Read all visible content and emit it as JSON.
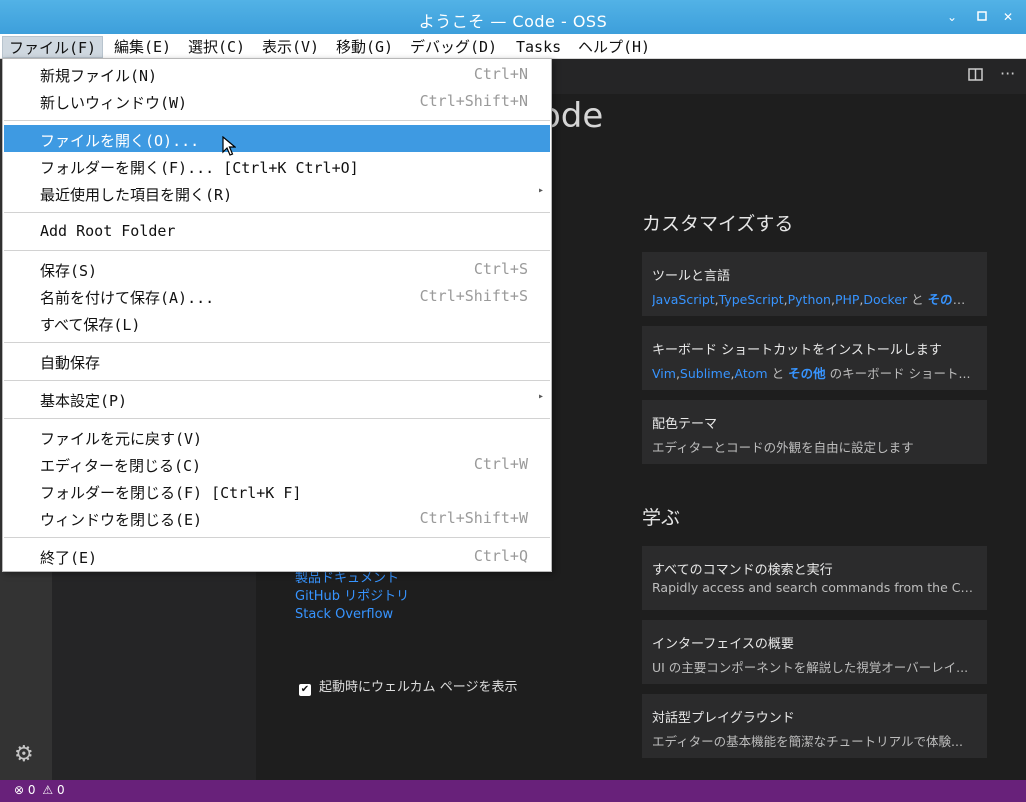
{
  "window": {
    "title": "ようこそ — Code - OSS"
  },
  "menubar": {
    "items": [
      "ファイル(F)",
      "編集(E)",
      "選択(C)",
      "表示(V)",
      "移動(G)",
      "デバッグ(D)",
      "Tasks",
      "ヘルプ(H)"
    ]
  },
  "file_menu": {
    "items": [
      {
        "label": "新規ファイル(N)",
        "shortcut": "Ctrl+N"
      },
      {
        "label": "新しいウィンドウ(W)",
        "shortcut": "Ctrl+Shift+N"
      },
      {
        "label": "ファイルを開く(O)...",
        "shortcut": ""
      },
      {
        "label": "フォルダーを開く(F)... [Ctrl+K Ctrl+O]",
        "shortcut": ""
      },
      {
        "label": "最近使用した項目を開く(R)",
        "shortcut": ""
      },
      {
        "label": "Add Root Folder",
        "shortcut": ""
      },
      {
        "label": "保存(S)",
        "shortcut": "Ctrl+S"
      },
      {
        "label": "名前を付けて保存(A)...",
        "shortcut": "Ctrl+Shift+S"
      },
      {
        "label": "すべて保存(L)",
        "shortcut": ""
      },
      {
        "label": "自動保存",
        "shortcut": ""
      },
      {
        "label": "基本設定(P)",
        "shortcut": ""
      },
      {
        "label": "ファイルを元に戻す(V)",
        "shortcut": ""
      },
      {
        "label": "エディターを閉じる(C)",
        "shortcut": "Ctrl+W"
      },
      {
        "label": "フォルダーを閉じる(F) [Ctrl+K F]",
        "shortcut": ""
      },
      {
        "label": "ウィンドウを閉じる(E)",
        "shortcut": "Ctrl+Shift+W"
      },
      {
        "label": "終了(E)",
        "shortcut": "Ctrl+Q"
      }
    ]
  },
  "welcome": {
    "title_fragment": "ode",
    "customize": {
      "heading": "カスタマイズする",
      "cards": [
        {
          "title": "ツールと言語",
          "links": [
            "JavaScript",
            "TypeScript",
            "Python",
            "PHP",
            "Docker"
          ],
          "conj": "と",
          "more": "その他",
          "tail": "..."
        },
        {
          "title": "キーボード ショートカットをインストールします",
          "links": [
            "Vim",
            "Sublime",
            "Atom"
          ],
          "conj": "と",
          "more": "その他",
          "tail": "のキーボード ショート..."
        },
        {
          "title": "配色テーマ",
          "desc": "エディターとコードの外観を自由に設定します"
        }
      ]
    },
    "learn": {
      "heading": "学ぶ",
      "cards": [
        {
          "title": "すべてのコマンドの検索と実行",
          "desc": "Rapidly access and search commands from the Com..."
        },
        {
          "title": "インターフェイスの概要",
          "desc": "UI の主要コンポーネントを解説した視覚オーバーレイ..."
        },
        {
          "title": "対話型プレイグラウンド",
          "desc": "エディターの基本機能を簡潔なチュートリアルで体験..."
        }
      ]
    },
    "help_links": [
      "製品ドキュメント",
      "GitHub リポジトリ",
      "Stack Overflow"
    ],
    "startup_label": "起動時にウェルカム ページを表示"
  },
  "statusbar": {
    "errors": "0",
    "warnings": "0"
  },
  "colors": {
    "accent": "#3e9ae2",
    "statusbar": "#68217a",
    "link": "#3794ff"
  }
}
